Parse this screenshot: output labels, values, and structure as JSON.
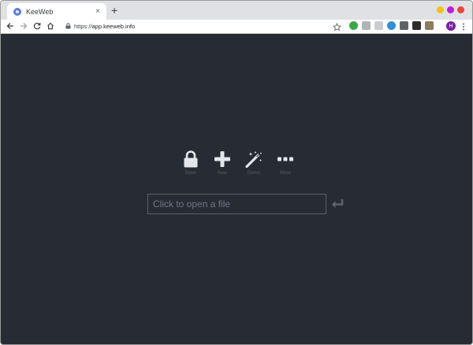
{
  "browser": {
    "tab": {
      "title": "KeeWeb",
      "close_symbol": "×"
    },
    "new_tab_symbol": "+",
    "url_scheme": "https://",
    "url_host": "app.keeweb.info",
    "profile_initial": "H",
    "window_dots": [
      "#f4c20d",
      "#c41adb",
      "#e8453c"
    ],
    "extensions": [
      {
        "name": "green-circle-ext-icon",
        "color": "#3ca845"
      },
      {
        "name": "gray-ext-icon",
        "color": "#b0b3b8"
      },
      {
        "name": "monitor-ext-icon",
        "color": "#c9ccd1"
      },
      {
        "name": "colorwheel-ext-icon",
        "color": "#2f8fd8"
      },
      {
        "name": "shield-ext-icon",
        "color": "#5f6368"
      },
      {
        "name": "evernote-ext-icon",
        "color": "#2d2d2d"
      },
      {
        "name": "card-ext-icon",
        "color": "#8a7d5e"
      }
    ]
  },
  "app": {
    "background": "#272b34",
    "actions": [
      {
        "name": "open-action",
        "icon": "lock-icon",
        "label": "Open"
      },
      {
        "name": "new-action",
        "icon": "plus-icon",
        "label": "New"
      },
      {
        "name": "demo-action",
        "icon": "magic-wand-icon",
        "label": "Demo"
      },
      {
        "name": "more-action",
        "icon": "more-icon",
        "label": "More"
      }
    ],
    "file_input": {
      "placeholder": "Click to open a file",
      "value": ""
    },
    "enter_icon": "enter-icon"
  }
}
